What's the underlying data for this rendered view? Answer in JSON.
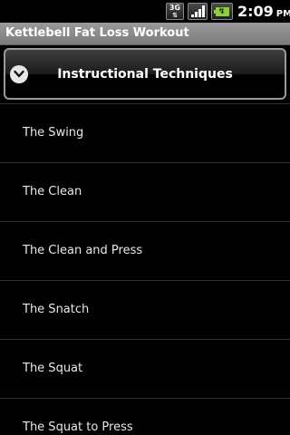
{
  "status_bar": {
    "network_type": "3G",
    "network_arrows": "⇅",
    "time": "2:09",
    "ampm": "PM",
    "icons": [
      "data-3g-icon",
      "signal-icon",
      "battery-charging-icon"
    ],
    "signal_bars": 4,
    "battery_color": "#8bd13a"
  },
  "title_bar": {
    "title": "Kettlebell Fat Loss Workout"
  },
  "section": {
    "label": "Instructional Techniques",
    "icon": "chevron-down-icon",
    "expanded": true
  },
  "list": {
    "items": [
      {
        "label": "The Swing"
      },
      {
        "label": "The Clean"
      },
      {
        "label": "The Clean and Press"
      },
      {
        "label": "The Snatch"
      },
      {
        "label": "The Squat"
      },
      {
        "label": "The Squat to Press"
      }
    ]
  },
  "colors": {
    "background": "#000000",
    "title_bar": "#8a8a8a",
    "text": "#e8e8e8",
    "divider": "#2f2f2f"
  }
}
